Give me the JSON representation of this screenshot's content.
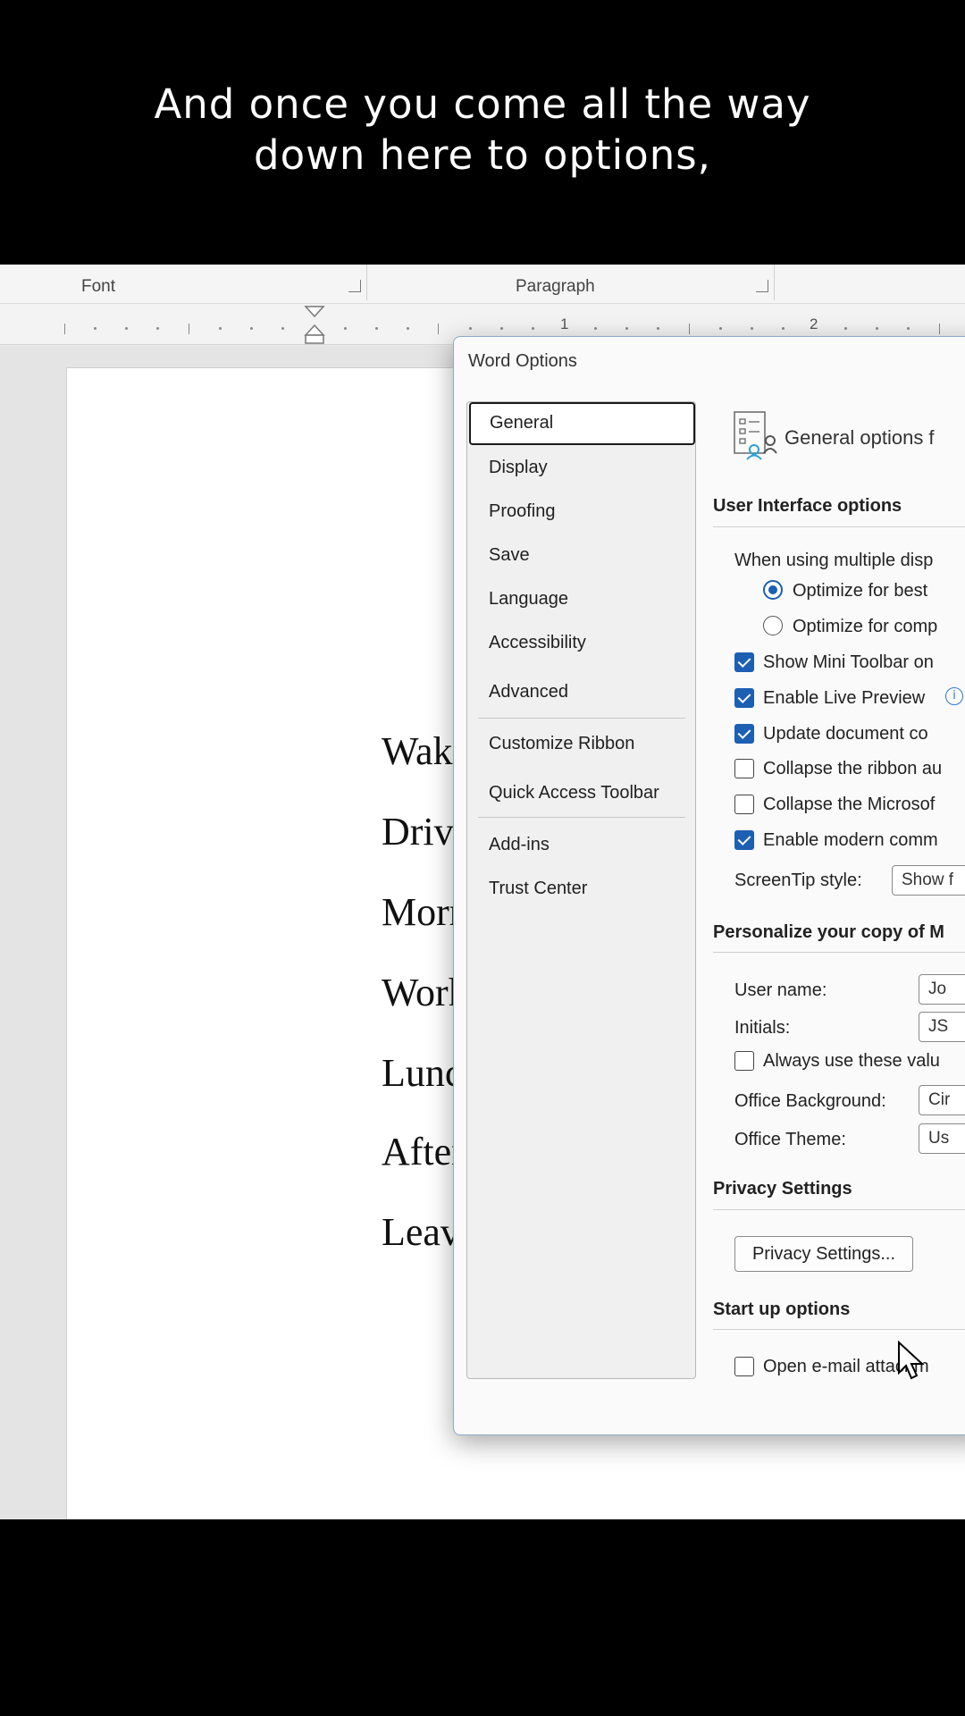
{
  "caption": {
    "line1": "And once you come all the way",
    "line2": "down here to options,"
  },
  "ribbon": {
    "groups": [
      "Font",
      "Paragraph"
    ]
  },
  "ruler": {
    "numbers": [
      "1",
      "2"
    ]
  },
  "document": {
    "lines": [
      "Wake up",
      "Drive to",
      "Morning",
      "Work on",
      "Lunch",
      "Afternoo",
      "Leave fo"
    ]
  },
  "dialog": {
    "title": "Word Options",
    "nav": [
      "General",
      "Display",
      "Proofing",
      "Save",
      "Language",
      "Accessibility",
      "Advanced",
      "Customize Ribbon",
      "Quick Access Toolbar",
      "Add-ins",
      "Trust Center"
    ],
    "selected_nav": "General",
    "header": "General options f",
    "sections": {
      "ui": "User Interface options",
      "personalize": "Personalize your copy of M",
      "privacy": "Privacy Settings",
      "startup": "Start up options"
    },
    "ui_options": {
      "multi_display": "When using multiple disp",
      "radio_best": "Optimize for best",
      "radio_compat": "Optimize for comp",
      "mini_toolbar": "Show Mini Toolbar on",
      "live_preview": "Enable Live Preview",
      "update_doc": "Update document co",
      "collapse_ribbon": "Collapse the ribbon au",
      "collapse_ms": "Collapse the Microsof",
      "modern_comments": "Enable modern comm",
      "screentip_label": "ScreenTip style:",
      "screentip_value": "Show f"
    },
    "checkbox_states": {
      "mini_toolbar": true,
      "live_preview": true,
      "update_doc": true,
      "collapse_ribbon": false,
      "collapse_ms": false,
      "modern_comments": true,
      "always_use": false,
      "open_email": false
    },
    "personalize": {
      "username_label": "User name:",
      "username_value": "Jo",
      "initials_label": "Initials:",
      "initials_value": "JS",
      "always_use": "Always use these valu",
      "background_label": "Office Background:",
      "background_value": "Cir",
      "theme_label": "Office Theme:",
      "theme_value": "Us"
    },
    "privacy_button": "Privacy Settings...",
    "startup_option": "Open e-mail attachm",
    "info_icon": "i"
  },
  "colors": {
    "accent": "#1c5fb3",
    "caption_bg": "#000000",
    "caption_text": "#ffffff"
  }
}
